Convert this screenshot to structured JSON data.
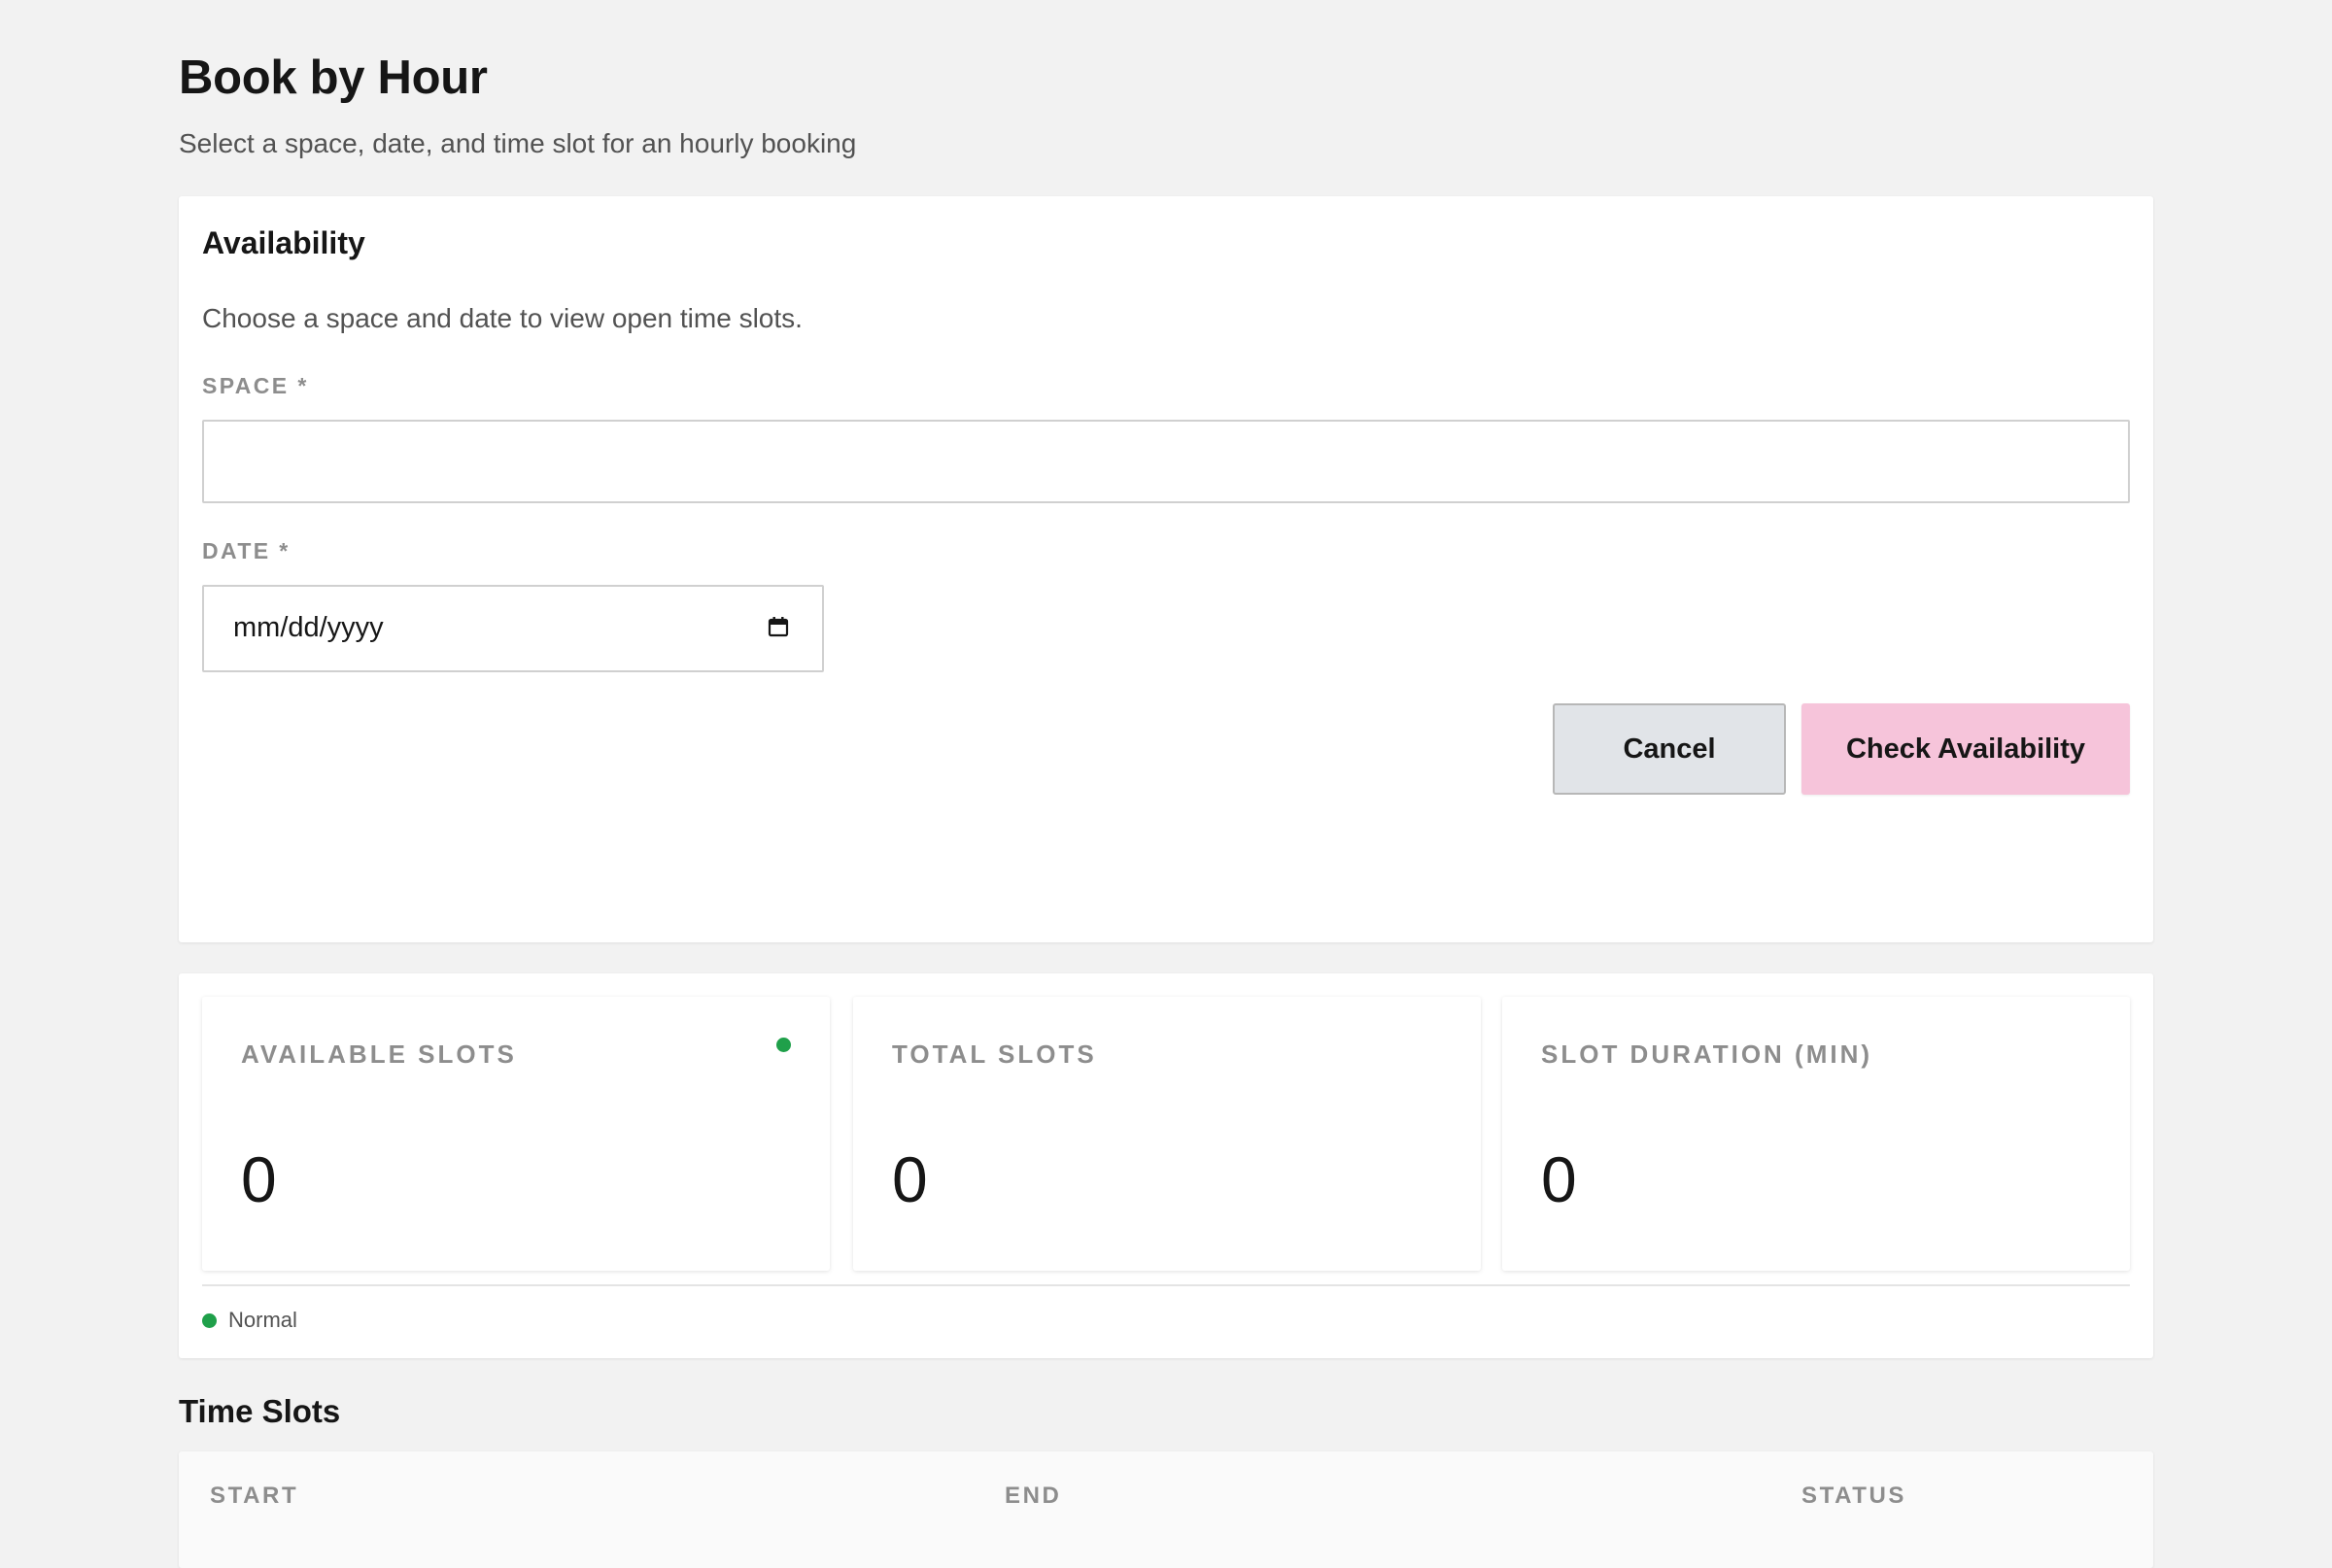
{
  "page": {
    "title": "Book by Hour",
    "subtitle": "Select a space, date, and time slot for an hourly booking"
  },
  "availability": {
    "heading": "Availability",
    "description": "Choose a space and date to view open time slots.",
    "space_label": "SPACE *",
    "space_value": "",
    "date_label": "DATE *",
    "date_placeholder": "mm/dd/yyyy",
    "cancel_label": "Cancel",
    "check_label": "Check Availability"
  },
  "stats": {
    "items": [
      {
        "label": "AVAILABLE SLOTS",
        "value": "0",
        "indicator": "status-dot"
      },
      {
        "label": "TOTAL SLOTS",
        "value": "0"
      },
      {
        "label": "SLOT DURATION (MIN)",
        "value": "0"
      }
    ],
    "legend": {
      "label": "Normal",
      "color": "#1fa04a"
    }
  },
  "time_slots": {
    "title": "Time Slots",
    "columns": [
      "START",
      "END",
      "STATUS"
    ],
    "rows": []
  },
  "colors": {
    "background": "#f2f2f2",
    "primary_button": "#f6c4da",
    "secondary_button": "#e1e4e8",
    "status_normal": "#1fa04a"
  }
}
